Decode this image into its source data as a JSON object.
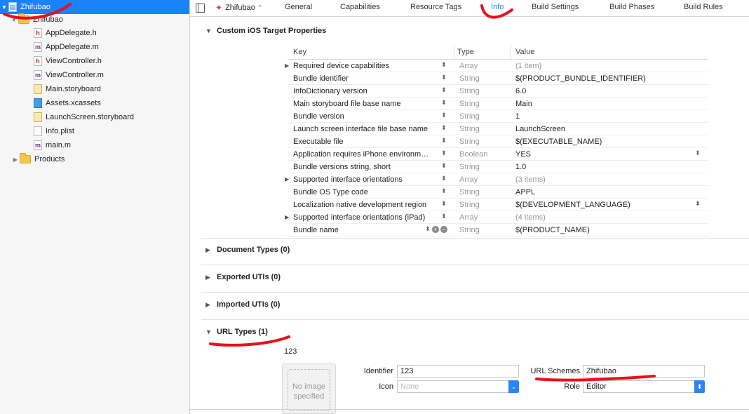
{
  "navigator": {
    "project": "Zhifubao",
    "group": "Zhifubao",
    "files": [
      {
        "label": "AppDelegate.h",
        "kind": "h"
      },
      {
        "label": "AppDelegate.m",
        "kind": "m"
      },
      {
        "label": "ViewController.h",
        "kind": "h"
      },
      {
        "label": "ViewController.m",
        "kind": "m"
      },
      {
        "label": "Main.storyboard",
        "kind": "storyboard"
      },
      {
        "label": "Assets.xcassets",
        "kind": "assets"
      },
      {
        "label": "LaunchScreen.storyboard",
        "kind": "storyboard"
      },
      {
        "label": "Info.plist",
        "kind": "plist"
      },
      {
        "label": "main.m",
        "kind": "m"
      }
    ],
    "products": "Products"
  },
  "tabbar": {
    "target": "Zhifubao",
    "tabs": [
      "General",
      "Capabilities",
      "Resource Tags",
      "Info",
      "Build Settings",
      "Build Phases",
      "Build Rules"
    ],
    "active": "Info"
  },
  "custom_props": {
    "title": "Custom iOS Target Properties",
    "col_key": "Key",
    "col_type": "Type",
    "col_value": "Value",
    "rows": [
      {
        "key": "Required device capabilities",
        "type": "Array",
        "value": "(1 item)"
      },
      {
        "key": "Bundle identifier",
        "type": "String",
        "value": "$(PRODUCT_BUNDLE_IDENTIFIER)"
      },
      {
        "key": "InfoDictionary version",
        "type": "String",
        "value": "6.0"
      },
      {
        "key": "Main storyboard file base name",
        "type": "String",
        "value": "Main"
      },
      {
        "key": "Bundle version",
        "type": "String",
        "value": "1"
      },
      {
        "key": "Launch screen interface file base name",
        "type": "String",
        "value": "LaunchScreen"
      },
      {
        "key": "Executable file",
        "type": "String",
        "value": "$(EXECUTABLE_NAME)"
      },
      {
        "key": "Application requires iPhone environm…",
        "type": "Boolean",
        "value": "YES"
      },
      {
        "key": "Bundle versions string, short",
        "type": "String",
        "value": "1.0"
      },
      {
        "key": "Supported interface orientations",
        "type": "Array",
        "value": "(3 items)"
      },
      {
        "key": "Bundle OS Type code",
        "type": "String",
        "value": "APPL"
      },
      {
        "key": "Localization native development region",
        "type": "String",
        "value": "$(DEVELOPMENT_LANGUAGE)"
      },
      {
        "key": "Supported interface orientations (iPad)",
        "type": "Array",
        "value": "(4 items)"
      },
      {
        "key": "Bundle name",
        "type": "String",
        "value": "$(PRODUCT_NAME)"
      }
    ]
  },
  "sections": {
    "document_types": "Document Types (0)",
    "exported_utis": "Exported UTIs (0)",
    "imported_utis": "Imported UTIs (0)",
    "url_types": "URL Types (1)"
  },
  "url_type": {
    "name": "123",
    "no_image": "No image specified",
    "identifier_label": "Identifier",
    "identifier": "123",
    "icon_label": "Icon",
    "icon_placeholder": "None",
    "url_schemes_label": "URL Schemes",
    "url_schemes": "Zhifubao",
    "role_label": "Role",
    "role": "Editor"
  },
  "colors": {
    "accent": "#1a82fb",
    "annotation": "#e8101b"
  }
}
